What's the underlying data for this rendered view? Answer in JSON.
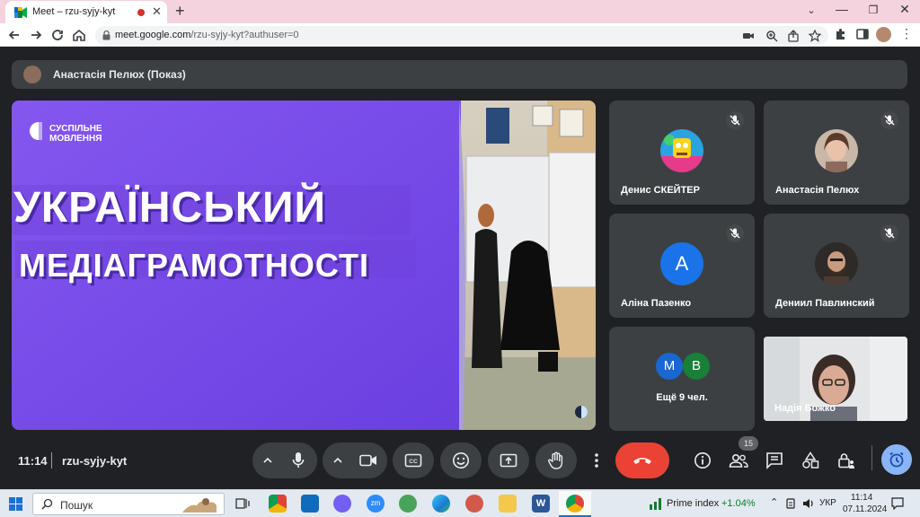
{
  "browser": {
    "tab_title": "Meet – rzu-syjy-kyt",
    "url_host": "meet.google.com",
    "url_path": "/rzu-syjy-kyt?authuser=0",
    "new_tab_label": "+"
  },
  "meet": {
    "presenter_label": "Анастасія Пелюх (Показ)",
    "slide": {
      "brand_line1": "СУСПІЛЬНЕ",
      "brand_line2": "МОВЛЕННЯ",
      "headline1": "УКРАЇНСЬКИЙ",
      "headline2": "МЕДІАГРАМОТНОСТІ"
    },
    "participants": [
      {
        "name": "Денис СКЕЙТЕР",
        "muted": true
      },
      {
        "name": "Анастасія Пелюх",
        "muted": true
      },
      {
        "name": "Аліна Пазенко",
        "muted": true,
        "initial": "A",
        "color": "#1a73e8"
      },
      {
        "name": "Дениил Павлинский",
        "muted": true
      },
      {
        "name": "Надія Божко",
        "muted": false
      }
    ],
    "others": {
      "label": "Ещё 9 чел.",
      "avatars": [
        {
          "initial": "M",
          "color": "#1967d2"
        },
        {
          "initial": "B",
          "color": "#188038"
        }
      ]
    },
    "controls": {
      "time": "11:14",
      "meeting_code": "rzu-syjy-kyt",
      "people_count": "15"
    }
  },
  "taskbar": {
    "search_placeholder": "Пошук",
    "prime_label": "Prime index",
    "prime_change": "+1.04%",
    "lang": "УКР",
    "clock_time": "11:14",
    "clock_date": "07.11.2024"
  },
  "colors": {
    "end_call": "#ea4335",
    "accent": "#8ab4f8",
    "slide_purple": "#7b4fe8",
    "tab_bar": "#f4d3df"
  }
}
